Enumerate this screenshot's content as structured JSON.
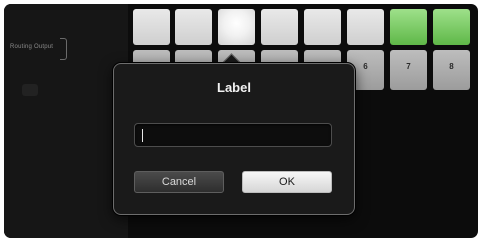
{
  "sidebar": {
    "routing_label": "Routing Output"
  },
  "grid": {
    "button_numbers": [
      "6",
      "7",
      "8"
    ]
  },
  "dialog": {
    "title": "Label",
    "input_value": "",
    "cancel_label": "Cancel",
    "ok_label": "OK"
  },
  "colors": {
    "highlight_button": "#5fb848",
    "dialog_bg": "#1a1a1a"
  }
}
